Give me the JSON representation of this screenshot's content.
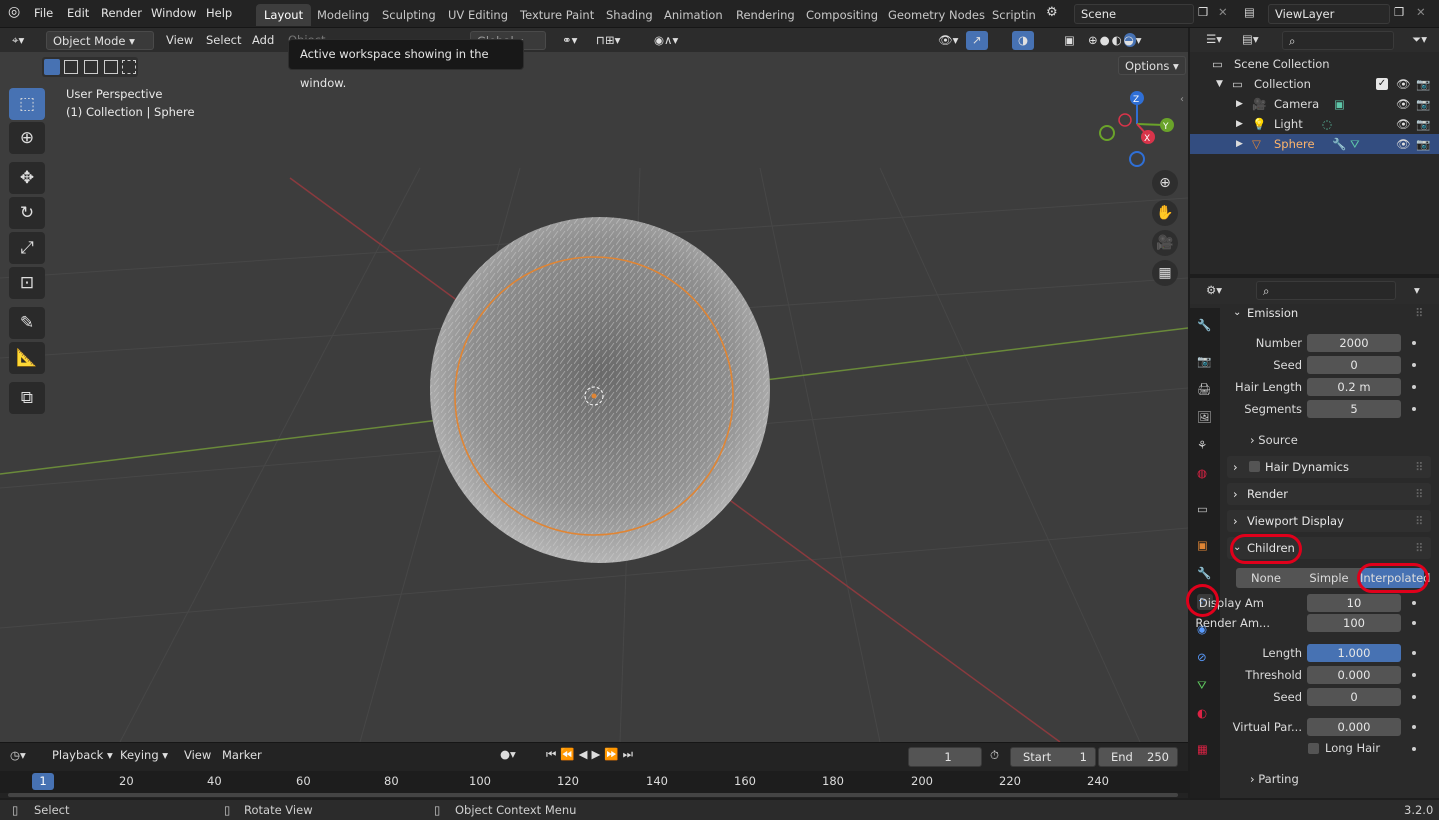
{
  "app": {
    "version": "3.2.0"
  },
  "menu": [
    "File",
    "Edit",
    "Render",
    "Window",
    "Help"
  ],
  "workspaces": [
    {
      "label": "Layout",
      "active": true
    },
    {
      "label": "Modeling"
    },
    {
      "label": "Sculpting"
    },
    {
      "label": "UV Editing"
    },
    {
      "label": "Texture Paint"
    },
    {
      "label": "Shading"
    },
    {
      "label": "Animation"
    },
    {
      "label": "Rendering"
    },
    {
      "label": "Compositing"
    },
    {
      "label": "Geometry Nodes"
    },
    {
      "label": "Scripting"
    }
  ],
  "scene": {
    "name": "Scene"
  },
  "view_layer": {
    "name": "ViewLayer"
  },
  "viewport": {
    "mode": "Object Mode",
    "menus": [
      "View",
      "Select",
      "Add",
      "Object"
    ],
    "orientation": "Global",
    "options_label": "Options",
    "perspective_label": "User Perspective",
    "context_label": "(1) Collection | Sphere",
    "gizmo_axes": [
      "Z",
      "Y",
      "X"
    ]
  },
  "tooltip": {
    "text": "Active workspace showing in the window."
  },
  "outliner": {
    "root": "Scene Collection",
    "collection": "Collection",
    "items": [
      {
        "name": "Camera",
        "selected": false
      },
      {
        "name": "Light",
        "selected": false
      },
      {
        "name": "Sphere",
        "selected": true
      }
    ]
  },
  "properties": {
    "emission": {
      "title": "Emission",
      "fields": [
        {
          "label": "Number",
          "value": "2000"
        },
        {
          "label": "Seed",
          "value": "0"
        },
        {
          "label": "Hair Length",
          "value": "0.2 m"
        },
        {
          "label": "Segments",
          "value": "5"
        }
      ],
      "source_label": "Source"
    },
    "hair_dynamics": {
      "title": "Hair Dynamics"
    },
    "render": {
      "title": "Render"
    },
    "viewport_display": {
      "title": "Viewport Display"
    },
    "children": {
      "title": "Children",
      "modes": [
        "None",
        "Simple",
        "Interpolated"
      ],
      "active_mode": "Interpolated",
      "fields": [
        {
          "label": "Display Am",
          "value": "10"
        },
        {
          "label": "Render Am...",
          "value": "100"
        },
        {
          "label": "Length",
          "value": "1.000",
          "selected": true
        },
        {
          "label": "Threshold",
          "value": "0.000"
        },
        {
          "label": "Seed",
          "value": "0"
        },
        {
          "label": "Virtual Par...",
          "value": "0.000"
        }
      ],
      "long_hair_label": "Long Hair",
      "parting_label": "Parting"
    }
  },
  "timeline": {
    "menus": [
      "Playback",
      "Keying",
      "View",
      "Marker"
    ],
    "current_frame": "1",
    "start_label": "Start",
    "start": "1",
    "end_label": "End",
    "end": "250",
    "ticks": [
      "20",
      "40",
      "60",
      "80",
      "100",
      "120",
      "140",
      "160",
      "180",
      "200",
      "220",
      "240"
    ],
    "marker": "1"
  },
  "status": {
    "select": "Select",
    "rotate": "Rotate View",
    "context_menu": "Object Context Menu"
  },
  "colors": {
    "accent": "#4772b3",
    "selection_outline": "#e08534",
    "highlight_ring": "#e0001b"
  }
}
